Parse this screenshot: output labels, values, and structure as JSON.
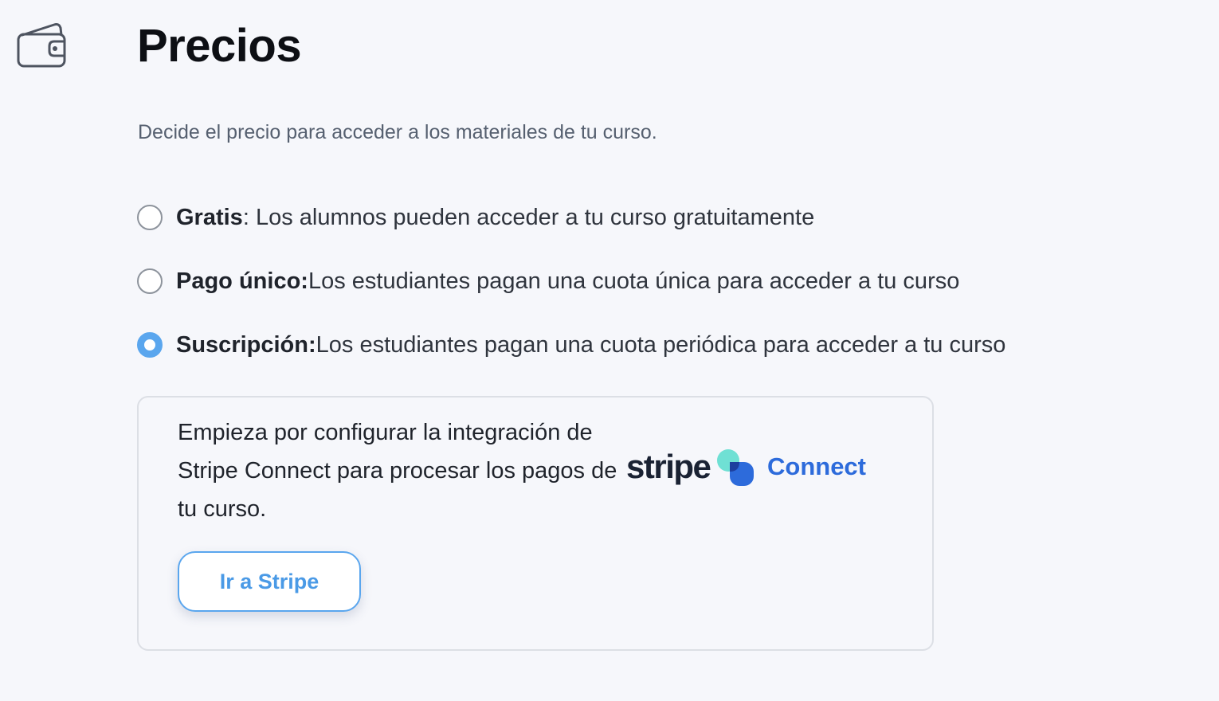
{
  "header": {
    "icon": "wallet-icon",
    "title": "Precios",
    "subtitle": "Decide el precio para acceder a los materiales de tu curso."
  },
  "pricing_options": [
    {
      "label": "Gratis",
      "description": ": Los alumnos pueden acceder a tu curso gratuitamente",
      "selected": false
    },
    {
      "label": "Pago único:",
      "description": " Los estudiantes pagan una cuota única para acceder a tu curso",
      "selected": false
    },
    {
      "label": "Suscripción:",
      "description": " Los estudiantes pagan una cuota periódica para acceder a tu curso",
      "selected": true
    }
  ],
  "stripe_card": {
    "description": "Empieza por configurar la integración de Stripe Connect para procesar los pagos de tu curso.",
    "button_label": "Ir a Stripe",
    "logo": {
      "brand": "stripe",
      "product": "Connect"
    }
  },
  "colors": {
    "accent": "#5aa6ee",
    "button_text": "#4a9ae6",
    "connect_blue": "#2d6bdb",
    "background": "#f6f7fb"
  }
}
